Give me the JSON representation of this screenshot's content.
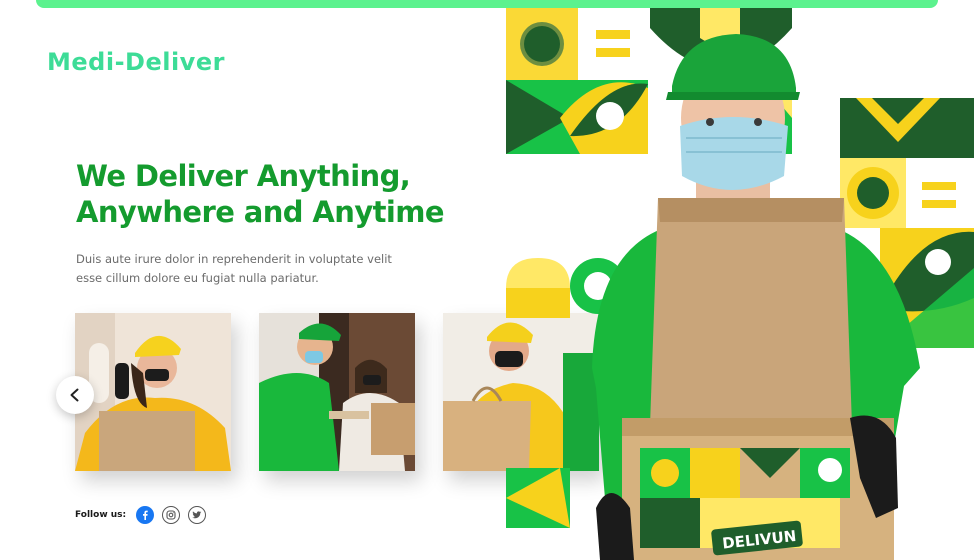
{
  "brand": {
    "name": "Medi-Deliver"
  },
  "hero": {
    "headline_line1": "We Deliver Anything,",
    "headline_line2": "Anywhere and Anytime",
    "description": "Duis aute irure dolor in reprehenderit in voluptate velit esse cillum dolore eu fugiat nulla pariatur.",
    "box_label": "DELIVUN"
  },
  "gallery": {
    "prev_icon": "chevron-left-icon",
    "items": [
      "courier-phone-photo",
      "courier-handover-photo",
      "courier-bag-photo"
    ]
  },
  "social": {
    "label": "Follow us:",
    "icons": [
      "facebook-icon",
      "instagram-icon",
      "twitter-icon"
    ]
  },
  "colors": {
    "accent_bar": "#5cf28e",
    "brand": "#3ddc97",
    "headline": "#149b2e",
    "pattern_green": "#1fc24a",
    "pattern_dark": "#1f5e2b",
    "pattern_yellow": "#f7d21c"
  }
}
